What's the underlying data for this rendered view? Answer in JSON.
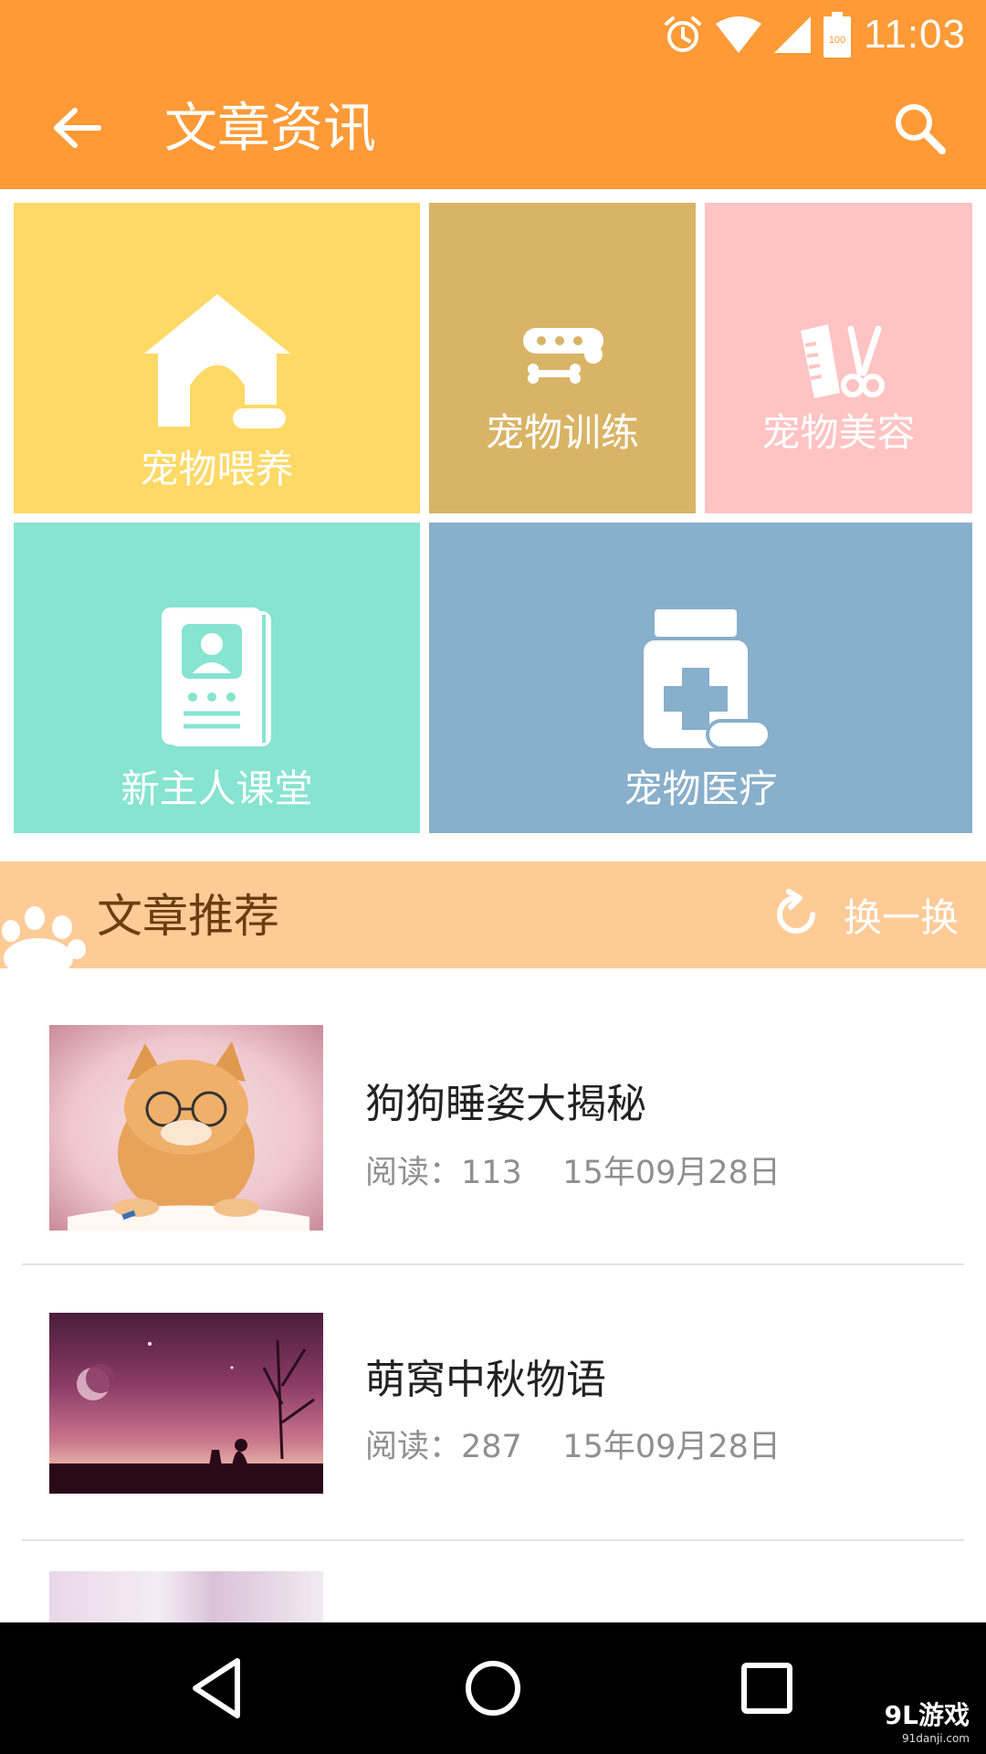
{
  "status_bar": {
    "time": "11:03",
    "battery_level": "100"
  },
  "header": {
    "title": "文章资讯"
  },
  "categories": [
    {
      "label": "宠物喂养",
      "icon": "doghouse-icon",
      "color": "#FFD966"
    },
    {
      "label": "宠物训练",
      "icon": "collar-bone-icon",
      "color": "#D9B466"
    },
    {
      "label": "宠物美容",
      "icon": "comb-scissors-icon",
      "color": "#FFC3C3"
    },
    {
      "label": "新主人课堂",
      "icon": "handbook-icon",
      "color": "#86E4D0"
    },
    {
      "label": "宠物医疗",
      "icon": "medicine-bottle-icon",
      "color": "#88AFCB"
    }
  ],
  "recommend": {
    "title": "文章推荐",
    "refresh_label": "换一换"
  },
  "articles": [
    {
      "title": "狗狗睡姿大揭秘",
      "meta": "阅读：113    15年09月28日"
    },
    {
      "title": "萌窝中秋物语",
      "meta": "阅读：287    15年09月28日"
    }
  ],
  "watermark": {
    "brand": "9L游戏",
    "site": "91danji.com"
  },
  "colors": {
    "accent": "#FF9A36",
    "section_bg": "#FECB97"
  }
}
